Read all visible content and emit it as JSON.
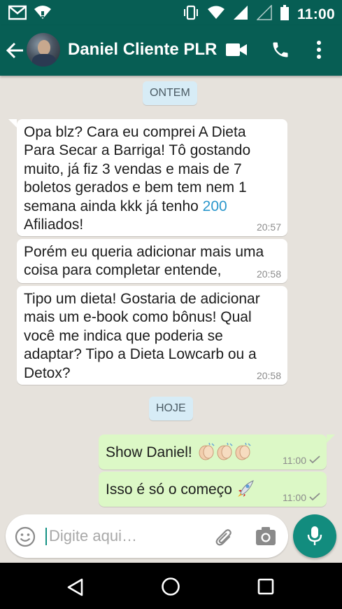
{
  "status_bar": {
    "time": "11:00",
    "icons": [
      "gmail-icon",
      "wifi-alt-icon",
      "vibrate-icon",
      "wifi-icon",
      "signal-icon",
      "signal-empty-icon",
      "battery-icon"
    ]
  },
  "header": {
    "contact_name": "Daniel Cliente PLR",
    "icons": [
      "back-arrow-icon",
      "avatar",
      "video-call-icon",
      "phone-icon",
      "more-vert-icon"
    ]
  },
  "chat": {
    "date_yesterday": "ONTEM",
    "date_today": "HOJE",
    "messages": [
      {
        "direction": "incoming",
        "text_before_link": "Opa blz? Cara eu comprei A Dieta Para Secar a Barriga! Tô gostando muito, já fiz 3 vendas e mais de 7 boletos gerados e bem tem nem 1 semana ainda kkk já tenho ",
        "link_text": "200",
        "text_after_link": " Afiliados!",
        "time": "20:57"
      },
      {
        "direction": "incoming",
        "text": "Porém eu queria adicionar mais uma coisa  para completar entende,",
        "time": "20:58"
      },
      {
        "direction": "incoming",
        "text": "Tipo um dieta! Gostaria de adicionar mais um e-book como bônus! Qual você me indica que poderia se adaptar? Tipo a Dieta Lowcarb ou a Detox?",
        "time": "20:58"
      },
      {
        "direction": "outgoing",
        "text": "Show Daniel! ",
        "emoji": [
          "clapping-hands-emoji",
          "clapping-hands-emoji",
          "clapping-hands-emoji"
        ],
        "time": "11:00",
        "status": "sent-check"
      },
      {
        "direction": "outgoing",
        "text": "Isso é só o começo ",
        "emoji": [
          "rocket-emoji"
        ],
        "time": "11:00",
        "status": "sent-check"
      }
    ]
  },
  "composer": {
    "placeholder": "Digite aqui…",
    "icons": [
      "emoji-icon",
      "attach-icon",
      "camera-icon",
      "mic-icon"
    ]
  },
  "nav_bar": {
    "icons": [
      "nav-back-icon",
      "nav-home-icon",
      "nav-recent-icon"
    ]
  },
  "colors": {
    "header": "#075e54",
    "outgoing_bubble": "#dcf8c6",
    "incoming_bubble": "#ffffff",
    "date_chip": "#d7ecf6",
    "chat_background": "#e6e2dc",
    "mic_button": "#128c7e",
    "link": "#2b97cc"
  }
}
